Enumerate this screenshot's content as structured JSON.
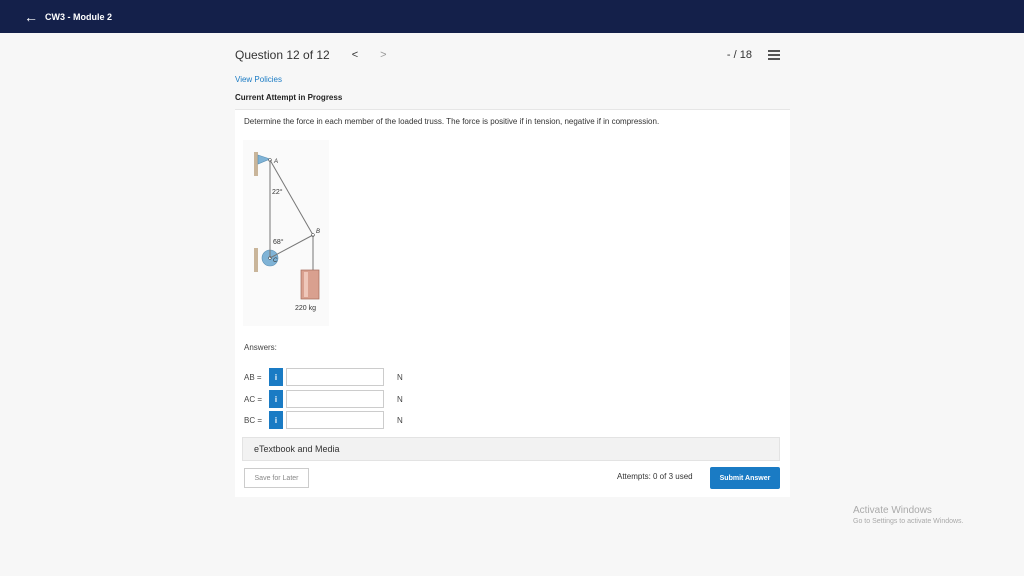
{
  "topbar": {
    "back_icon": "arrow-left-icon",
    "title": "CW3 - Module 2"
  },
  "question_header": {
    "title": "Question 12 of 12",
    "prev": "<",
    "next": ">",
    "score": "- / 18",
    "list_icon": "list-icon"
  },
  "policies": "View Policies",
  "attempt_status": "Current Attempt in Progress",
  "prompt": "Determine the force in each member of the loaded truss. The force is positive if in tension, negative if in compression.",
  "figure": {
    "point_a": "A",
    "point_b": "B",
    "point_c": "C",
    "angle_top": "22°",
    "angle_bottom": "68°",
    "mass": "220 kg"
  },
  "answers": {
    "label": "Answers:",
    "rows": [
      {
        "label": "AB =",
        "info": "i",
        "value": "",
        "unit": "N"
      },
      {
        "label": "AC =",
        "info": "i",
        "value": "",
        "unit": "N"
      },
      {
        "label": "BC =",
        "info": "i",
        "value": "",
        "unit": "N"
      }
    ]
  },
  "etextbook": "eTextbook and Media",
  "save_later": "Save for Later",
  "attempts": "Attempts: 0 of 3 used",
  "submit": "Submit Answer",
  "watermark": {
    "line1": "Activate Windows",
    "line2": "Go to Settings to activate Windows."
  },
  "colors": {
    "topbar": "#14204a",
    "accent": "#1a7bc4"
  }
}
